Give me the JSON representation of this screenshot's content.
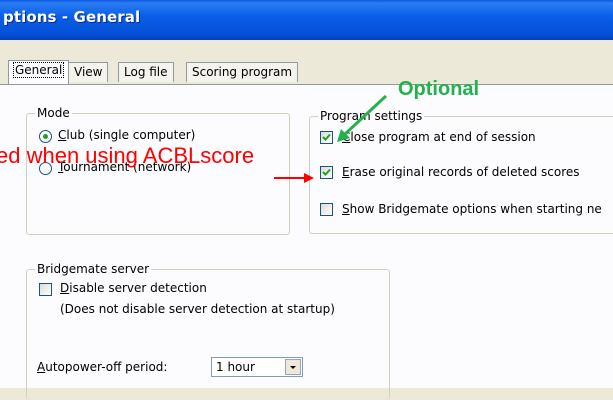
{
  "window": {
    "title": "ptions - General"
  },
  "tabs": [
    {
      "label": "General",
      "active": true
    },
    {
      "label": "View"
    },
    {
      "label": "Log file"
    },
    {
      "label": "Scoring program"
    }
  ],
  "mode_group": {
    "legend": "Mode",
    "options": [
      {
        "label_underlined": "C",
        "label_rest": "lub (single computer)",
        "selected": true
      },
      {
        "label_underlined": "T",
        "label_rest": "ournament (network)",
        "selected": false
      }
    ]
  },
  "program_settings": {
    "legend": "Program settings",
    "items": [
      {
        "label_underlined": "C",
        "label_rest": "lose program at end of session",
        "checked": true
      },
      {
        "label_underlined": "E",
        "label_rest": "rase original records of deleted scores",
        "checked": true
      },
      {
        "label_underlined": "S",
        "label_rest": "how Bridgemate options when starting ne",
        "checked": false
      }
    ]
  },
  "bridgemate_server": {
    "legend": "Bridgemate server",
    "disable_label_underlined": "D",
    "disable_label_rest": "isable server detection",
    "disable_checked": false,
    "disable_note": "(Does not disable server detection at startup)",
    "autopower_label_underlined": "A",
    "autopower_label_rest": "utopower-off period:",
    "autopower_value": "1 hour"
  },
  "annotations": {
    "red_text": "ed when using ACBLscore",
    "green_text": "Optional",
    "red_color": "#ff0000",
    "green_color": "#22b14c"
  }
}
